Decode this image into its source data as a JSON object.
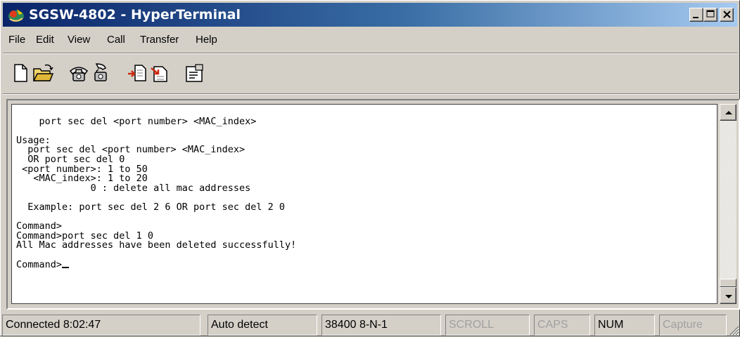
{
  "window": {
    "title": "SGSW-4802 - HyperTerminal",
    "controls": {
      "minimize": "minimize",
      "maximize": "maximize",
      "close": "close"
    }
  },
  "menu": {
    "items": [
      "File",
      "Edit",
      "View",
      "Call",
      "Transfer",
      "Help"
    ]
  },
  "toolbar": {
    "buttons": [
      {
        "icon": "new-document-icon"
      },
      {
        "icon": "open-folder-icon"
      },
      {
        "icon": "call-phone-icon"
      },
      {
        "icon": "disconnect-phone-icon"
      },
      {
        "icon": "send-file-icon"
      },
      {
        "icon": "receive-file-icon"
      },
      {
        "icon": "properties-icon"
      }
    ]
  },
  "terminal": {
    "lines": [
      "",
      "    port sec del <port number> <MAC_index>",
      "",
      "Usage:",
      "  port sec del <port number> <MAC_index>",
      "  OR port sec del 0",
      " <port number>: 1 to 50",
      "   <MAC_index>: 1 to 20",
      "             0 : delete all mac addresses",
      "",
      "  Example: port sec del 2 6 OR port sec del 2 0",
      "",
      "Command>",
      "Command>port sec del 1 0",
      "All Mac addresses have been deleted successfully!",
      "",
      "Command>"
    ]
  },
  "statusbar": {
    "connected": "Connected 8:02:47",
    "detect": "Auto detect",
    "settings": "38400 8-N-1",
    "scroll": "SCROLL",
    "caps": "CAPS",
    "num": "NUM",
    "capture": "Capture"
  },
  "colors": {
    "title_start": "#0a246a",
    "title_end": "#a6caf0",
    "chrome": "#d4d0c8",
    "terminal_bg": "#ffffff",
    "terminal_fg": "#000000",
    "disabled_text": "#a0a0a0"
  }
}
